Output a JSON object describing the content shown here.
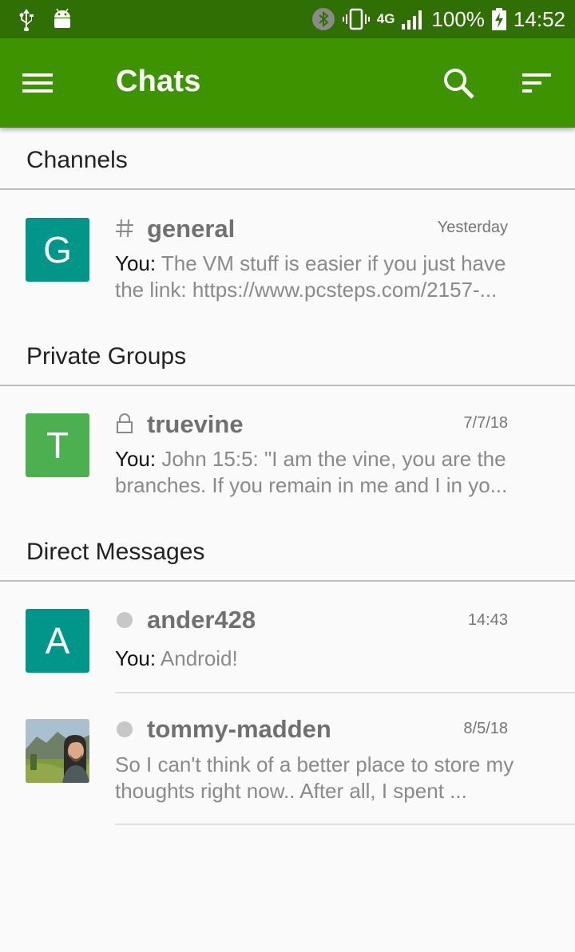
{
  "status_bar": {
    "network": "4G",
    "battery": "100%",
    "time": "14:52"
  },
  "app_bar": {
    "title": "Chats",
    "menu_icon": "hamburger-menu-icon",
    "search_icon": "search-icon",
    "sort_icon": "sort-icon"
  },
  "colors": {
    "status_bar": "#2f6f04",
    "app_bar": "#3d9400",
    "avatar_teal": "#00968a",
    "avatar_green": "#4caf50",
    "status_dot": "#c7c7c7"
  },
  "sections": {
    "channels": {
      "title": "Channels",
      "items": [
        {
          "name": "general",
          "icon": "hashtag-icon",
          "avatar_letter": "G",
          "time": "Yesterday",
          "sender": "You:",
          "message": " The VM stuff is easier if you just have the link: https://www.pcsteps.com/2157-..."
        }
      ]
    },
    "private_groups": {
      "title": "Private Groups",
      "items": [
        {
          "name": "truevine",
          "icon": "lock-icon",
          "avatar_letter": "T",
          "time": "7/7/18",
          "sender": "You:",
          "message": " John 15:5: \"I am the vine, you are the branches. If you remain in me and I in yo..."
        }
      ]
    },
    "direct_messages": {
      "title": "Direct Messages",
      "items": [
        {
          "name": "ander428",
          "icon": "offline-status-icon",
          "avatar_letter": "A",
          "time": "14:43",
          "sender": "You:",
          "message": " Android!"
        },
        {
          "name": "tommy-madden",
          "icon": "offline-status-icon",
          "avatar": "user-photo-avatar",
          "time": "8/5/18",
          "message": "So I can't think of a better place to store my thoughts right now.. After all, I spent ..."
        }
      ]
    }
  }
}
